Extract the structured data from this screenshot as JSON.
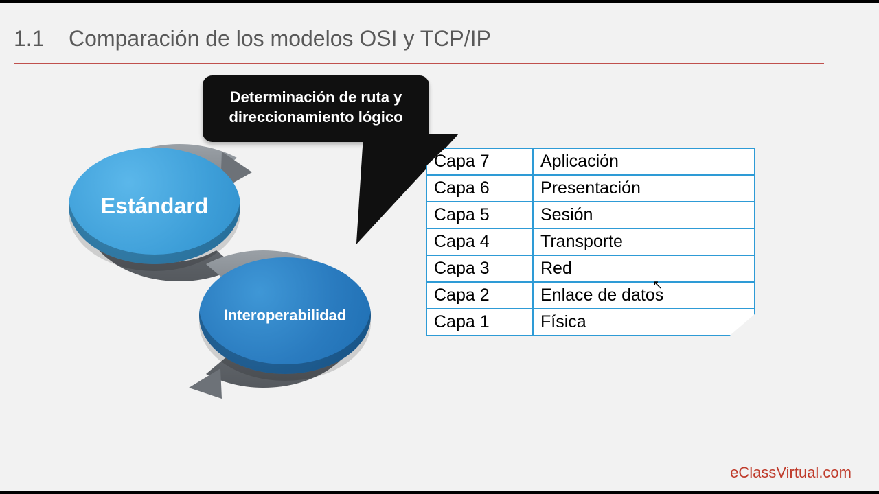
{
  "header": {
    "number": "1.1",
    "title": "Comparación de los modelos OSI y TCP/IP"
  },
  "discs": {
    "light": "Estándard",
    "dark": "Interoperabilidad"
  },
  "bubble": {
    "text": "Determinación de ruta y direccionamiento lógico"
  },
  "osi_layers": [
    {
      "layer": "Capa 7",
      "name": "Aplicación"
    },
    {
      "layer": "Capa 6",
      "name": "Presentación"
    },
    {
      "layer": "Capa 5",
      "name": "Sesión"
    },
    {
      "layer": "Capa 4",
      "name": "Transporte"
    },
    {
      "layer": "Capa 3",
      "name": "Red"
    },
    {
      "layer": "Capa 2",
      "name": "Enlace de datos"
    },
    {
      "layer": "Capa 1",
      "name": "Física"
    }
  ],
  "attribution": "eClassVirtual.com",
  "colors": {
    "accent_rule": "#c0504d",
    "table_border": "#2e9bd6",
    "light_disc": "#3d9ed8",
    "dark_disc": "#2a7bbf"
  }
}
